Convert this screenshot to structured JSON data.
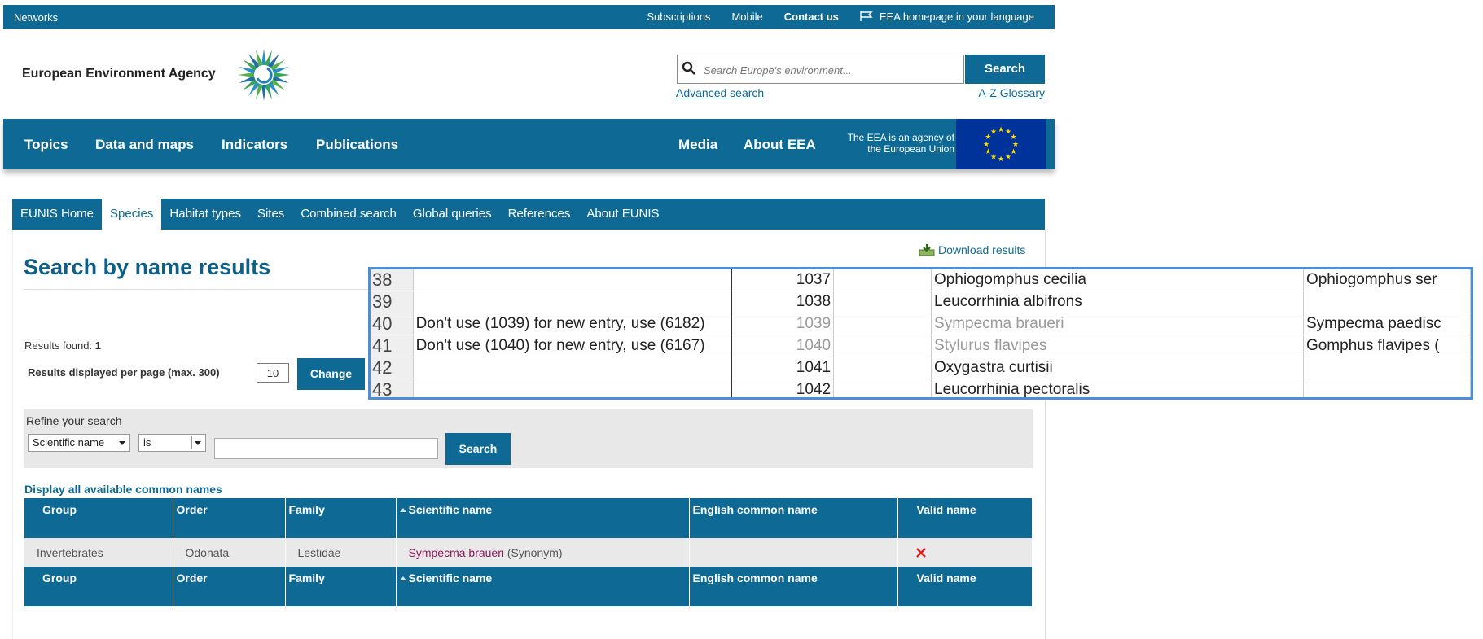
{
  "topbar": {
    "networks": "Networks",
    "links": [
      "Subscriptions",
      "Mobile",
      "Contact us"
    ],
    "language_link": "EEA homepage in your language"
  },
  "header": {
    "logo_text": "European Environment Agency",
    "search_placeholder": "Search Europe's environment...",
    "search_button": "Search",
    "advanced_search": "Advanced search",
    "glossary": "A-Z Glossary"
  },
  "main_nav": {
    "items": [
      "Topics",
      "Data and maps",
      "Indicators",
      "Publications",
      "Media",
      "About EEA"
    ],
    "eu_text_line1": "The EEA is an agency of",
    "eu_text_line2": "the European Union"
  },
  "eunis_tabs": [
    "EUNIS Home",
    "Species",
    "Habitat types",
    "Sites",
    "Combined search",
    "Global queries",
    "References",
    "About EUNIS"
  ],
  "results": {
    "download": "Download results",
    "title": "Search by name results",
    "found_label": "Results found:",
    "found_count": "1",
    "per_page_label": "Results displayed per page (max. 300)",
    "per_page_value": "10",
    "change_button": "Change"
  },
  "refine": {
    "label": "Refine your search",
    "field_select": "Scientific name",
    "operator_select": "is",
    "search_button": "Search"
  },
  "display_all": "Display all available common names",
  "table": {
    "headers": [
      "Group",
      "Order",
      "Family",
      "Scientific name",
      "English common name",
      "Valid name"
    ],
    "rows": [
      {
        "group": "Invertebrates",
        "order": "Odonata",
        "family": "Lestidae",
        "scientific": "Sympecma braueri",
        "status": "(Synonym)",
        "english": "",
        "valid": "invalid-x-icon"
      }
    ]
  },
  "overlay": {
    "rows": [
      {
        "rownum": "38",
        "note": "",
        "code": "1037",
        "name": "Ophiogomphus cecilia",
        "alt": "Ophiogomphus ser",
        "grey": false
      },
      {
        "rownum": "39",
        "note": "",
        "code": "1038",
        "name": "Leucorrhinia albifrons",
        "alt": "",
        "grey": false
      },
      {
        "rownum": "40",
        "note": "Don't use (1039) for new entry, use (6182)",
        "code": "1039",
        "name": "Sympecma braueri",
        "alt": "Sympecma paedisc",
        "grey": true
      },
      {
        "rownum": "41",
        "note": "Don't use (1040) for new entry, use (6167)",
        "code": "1040",
        "name": "Stylurus flavipes",
        "alt": "Gomphus flavipes (",
        "grey": true
      },
      {
        "rownum": "42",
        "note": "",
        "code": "1041",
        "name": "Oxygastra curtisii",
        "alt": "",
        "grey": false
      },
      {
        "rownum": "43",
        "note": "",
        "code": "1042",
        "name": "Leucorrhinia pectoralis",
        "alt": "",
        "grey": false
      }
    ]
  }
}
